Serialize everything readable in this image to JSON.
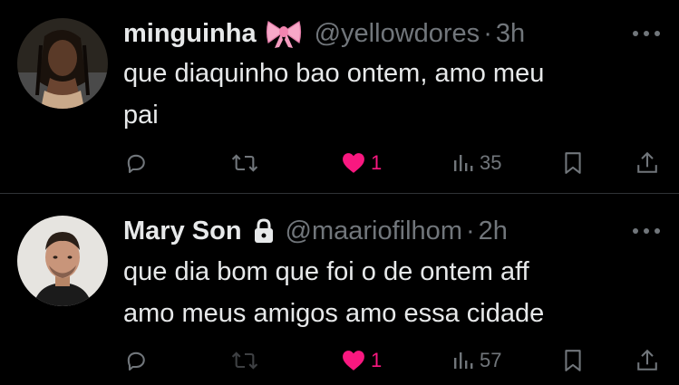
{
  "colors": {
    "background": "#000000",
    "primary_text": "#e7e9ea",
    "secondary_text": "#71767b",
    "like_pink": "#f91880",
    "divider": "#2f3336"
  },
  "tweets": [
    {
      "display_name": "minguinha",
      "badge_icon": "ribbon-bow-emoji",
      "handle": "@yellowdores",
      "separator": "·",
      "time": "3h",
      "text_lines": [
        "que diaquinho bao ontem, amo meu",
        "pai"
      ],
      "actions": {
        "reply_count": "",
        "retweet_count": "",
        "like_count": "1",
        "liked": true,
        "views_count": "35"
      }
    },
    {
      "display_name": "Mary Son",
      "badge_icon": "lock-icon",
      "handle": "@maariofilhom",
      "separator": "·",
      "time": "2h",
      "text_lines": [
        "que dia bom que foi o de ontem aff",
        "amo meus amigos amo essa cidade"
      ],
      "actions": {
        "reply_count": "",
        "retweet_count": "",
        "like_count": "1",
        "liked": true,
        "views_count": "57"
      }
    }
  ]
}
